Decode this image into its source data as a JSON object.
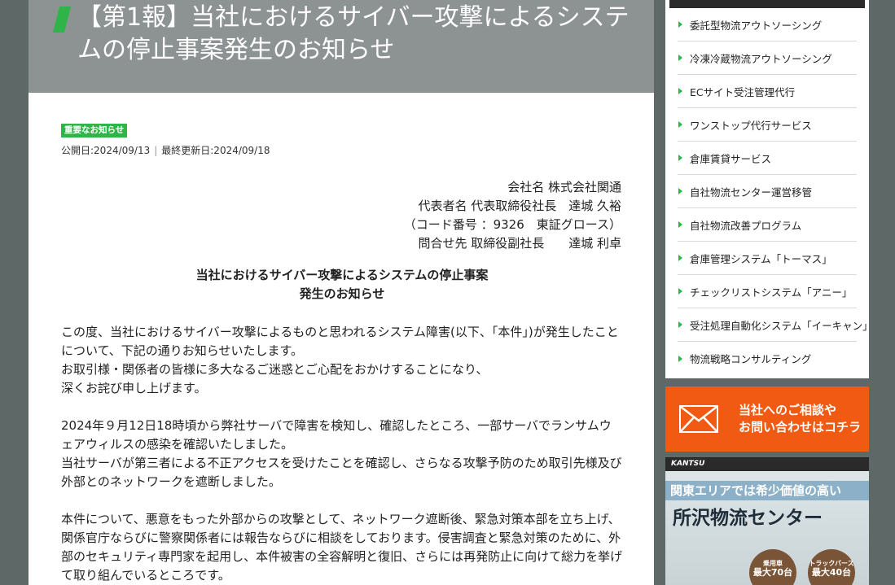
{
  "article": {
    "title": "【第1報】当社におけるサイバー攻撃によるシステムの停止事案発生のお知らせ",
    "badge": "重要なお知らせ",
    "published": "公開日:2024/09/13",
    "updated": "最終更新日:2024/09/18",
    "date_separator": "|",
    "company_lines": [
      "会社名 株式会社関通",
      "代表者名 代表取締役社長　達城 久裕",
      "（コード番号 ：9326　東証グロース）",
      "問合せ先 取締役副社長　　達城 利卓"
    ],
    "notice_title_lines": [
      "当社におけるサイバー攻撃によるシステムの停止事案",
      "発生のお知らせ"
    ],
    "paragraphs": [
      [
        "この度、当社におけるサイバー攻撃によるものと思われるシステム障害(以下、「本件」)が発生したことについて、下記の通りお知らせいたします。",
        "お取引様・関係者の皆様に多大なるご迷惑とご心配をおかけすることになり、",
        "深くお詫び申し上げます。"
      ],
      [
        "2024年９月12日18時頃から弊社サーバで障害を検知し、確認したところ、一部サーバでランサムウェアウィルスの感染を確認いたしました。",
        "当社サーバが第三者による不正アクセスを受けたことを確認し、さらなる攻撃予防のため取引先様及び外部とのネットワークを遮断しました。"
      ],
      [
        "本件について、悪意をもった外部からの攻撃として、ネットワーク遮断後、緊急対策本部を立ち上げ、関係官庁ならびに警察関係者には報告ならびに相談をしております。侵害調査と緊急対策のために、外部のセキュリティ専門家を起用し、本件被害の全容解明と復旧、さらには再発防止に向けて総力を挙げて取り組んでいるところです。"
      ]
    ]
  },
  "sidebar": {
    "menu": [
      "委託型物流アウトソーシング",
      "冷凍冷蔵物流アウトソーシング",
      "ECサイト受注管理代行",
      "ワンストップ代行サービス",
      "倉庫賃貸サービス",
      "自社物流センター運営移管",
      "自社物流改善プログラム",
      "倉庫管理システム「トーマス」",
      "チェックリストシステム「アニー」",
      "受注処理自動化システム「イーキャン」",
      "物流戦略コンサルティング"
    ],
    "contact": {
      "line1": "当社へのご相談や",
      "line2": "お問い合わせはコチラ"
    },
    "ad": {
      "logo": "KANTSU",
      "strip": "関東エリアでは希少価値の高い",
      "headline": "所沢物流センター",
      "circle1_top": "乗用車",
      "circle1_main": "最大70台",
      "circle2_top": "トラックバース",
      "circle2_main": "最大40台"
    }
  },
  "colors": {
    "accent_green": "#2fb44a",
    "contact_orange": "#f05a13",
    "page_background": "#5e6867",
    "title_band": "#8d9293"
  }
}
